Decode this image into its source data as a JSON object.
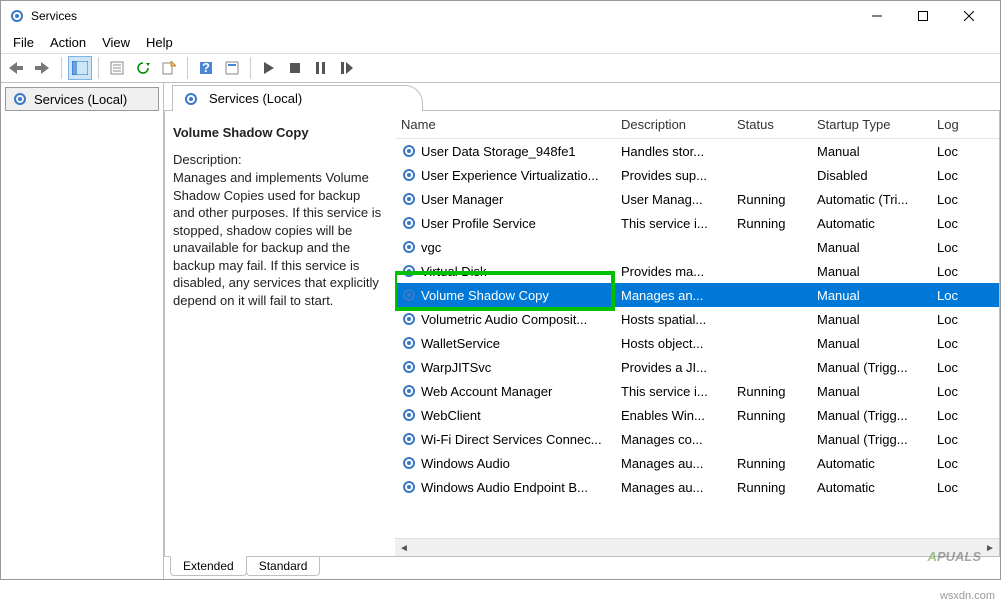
{
  "window": {
    "title": "Services"
  },
  "menu": {
    "file": "File",
    "action": "Action",
    "view": "View",
    "help": "Help"
  },
  "sidebar": {
    "item0": "Services (Local)"
  },
  "contentTab": {
    "title": "Services (Local)"
  },
  "detail": {
    "title": "Volume Shadow Copy",
    "descLabel": "Description:",
    "desc": "Manages and implements Volume Shadow Copies used for backup and other purposes. If this service is stopped, shadow copies will be unavailable for backup and the backup may fail. If this service is disabled, any services that explicitly depend on it will fail to start."
  },
  "columns": {
    "name": "Name",
    "desc": "Description",
    "status": "Status",
    "startup": "Startup Type",
    "logon": "Log"
  },
  "services": [
    {
      "name": "User Data Storage_948fe1",
      "desc": "Handles stor...",
      "status": "",
      "startup": "Manual",
      "logon": "Loc"
    },
    {
      "name": "User Experience Virtualizatio...",
      "desc": "Provides sup...",
      "status": "",
      "startup": "Disabled",
      "logon": "Loc"
    },
    {
      "name": "User Manager",
      "desc": "User Manag...",
      "status": "Running",
      "startup": "Automatic (Tri...",
      "logon": "Loc"
    },
    {
      "name": "User Profile Service",
      "desc": "This service i...",
      "status": "Running",
      "startup": "Automatic",
      "logon": "Loc"
    },
    {
      "name": "vgc",
      "desc": "",
      "status": "",
      "startup": "Manual",
      "logon": "Loc"
    },
    {
      "name": "Virtual Disk",
      "desc": "Provides ma...",
      "status": "",
      "startup": "Manual",
      "logon": "Loc"
    },
    {
      "name": "Volume Shadow Copy",
      "desc": "Manages an...",
      "status": "",
      "startup": "Manual",
      "logon": "Loc"
    },
    {
      "name": "Volumetric Audio Composit...",
      "desc": "Hosts spatial...",
      "status": "",
      "startup": "Manual",
      "logon": "Loc"
    },
    {
      "name": "WalletService",
      "desc": "Hosts object...",
      "status": "",
      "startup": "Manual",
      "logon": "Loc"
    },
    {
      "name": "WarpJITSvc",
      "desc": "Provides a JI...",
      "status": "",
      "startup": "Manual (Trigg...",
      "logon": "Loc"
    },
    {
      "name": "Web Account Manager",
      "desc": "This service i...",
      "status": "Running",
      "startup": "Manual",
      "logon": "Loc"
    },
    {
      "name": "WebClient",
      "desc": "Enables Win...",
      "status": "Running",
      "startup": "Manual (Trigg...",
      "logon": "Loc"
    },
    {
      "name": "Wi-Fi Direct Services Connec...",
      "desc": "Manages co...",
      "status": "",
      "startup": "Manual (Trigg...",
      "logon": "Loc"
    },
    {
      "name": "Windows Audio",
      "desc": "Manages au...",
      "status": "Running",
      "startup": "Automatic",
      "logon": "Loc"
    },
    {
      "name": "Windows Audio Endpoint B...",
      "desc": "Manages au...",
      "status": "Running",
      "startup": "Automatic",
      "logon": "Loc"
    }
  ],
  "selectedIndex": 6,
  "bottomTabs": {
    "extended": "Extended",
    "standard": "Standard"
  },
  "watermarkA": "A",
  "watermarkRest": "PUALS",
  "source": "wsxdn.com"
}
